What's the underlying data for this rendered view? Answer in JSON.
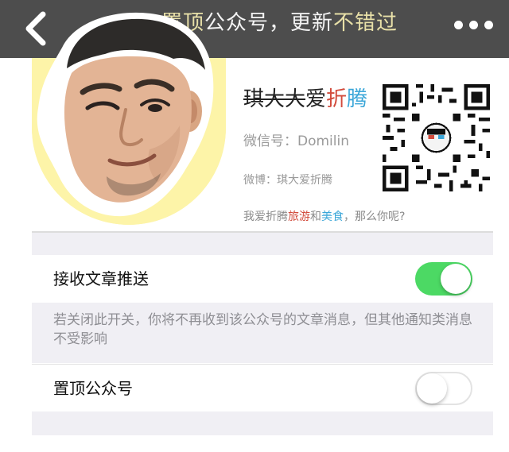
{
  "topbar": {
    "title_gold_1": "置顶",
    "title_white_1": "公众号，更新",
    "title_gold_2": "不错过",
    "back_icon": "chevron-left-icon",
    "more_icon": "more-dots-icon"
  },
  "profile": {
    "name_strike": "琪大大",
    "name_plain": "爱",
    "name_red": "折",
    "name_blue": "腾",
    "wechat_id": "微信号：Domilin",
    "weibo": "微博：琪大爱折腾",
    "tagline_pre": "我爱折腾",
    "tagline_red": "旅游",
    "tagline_mid": "和",
    "tagline_blue": "美食",
    "tagline_post": "，那么你呢?",
    "qr_icon": "qr-code-icon"
  },
  "settings": {
    "receive_push_label": "接收文章推送",
    "receive_push_on": true,
    "receive_push_hint": "若关闭此开关，你将不再收到该公众号的文章消息，但其他通知类消息不受影响",
    "pin_top_label": "置顶公众号",
    "pin_top_on": false
  },
  "colors": {
    "topbar_bg": "#4d4d4d",
    "title_gold": "#e8e0a8",
    "toggle_on": "#4cd964",
    "avatar_circle": "#fdf4a8"
  }
}
